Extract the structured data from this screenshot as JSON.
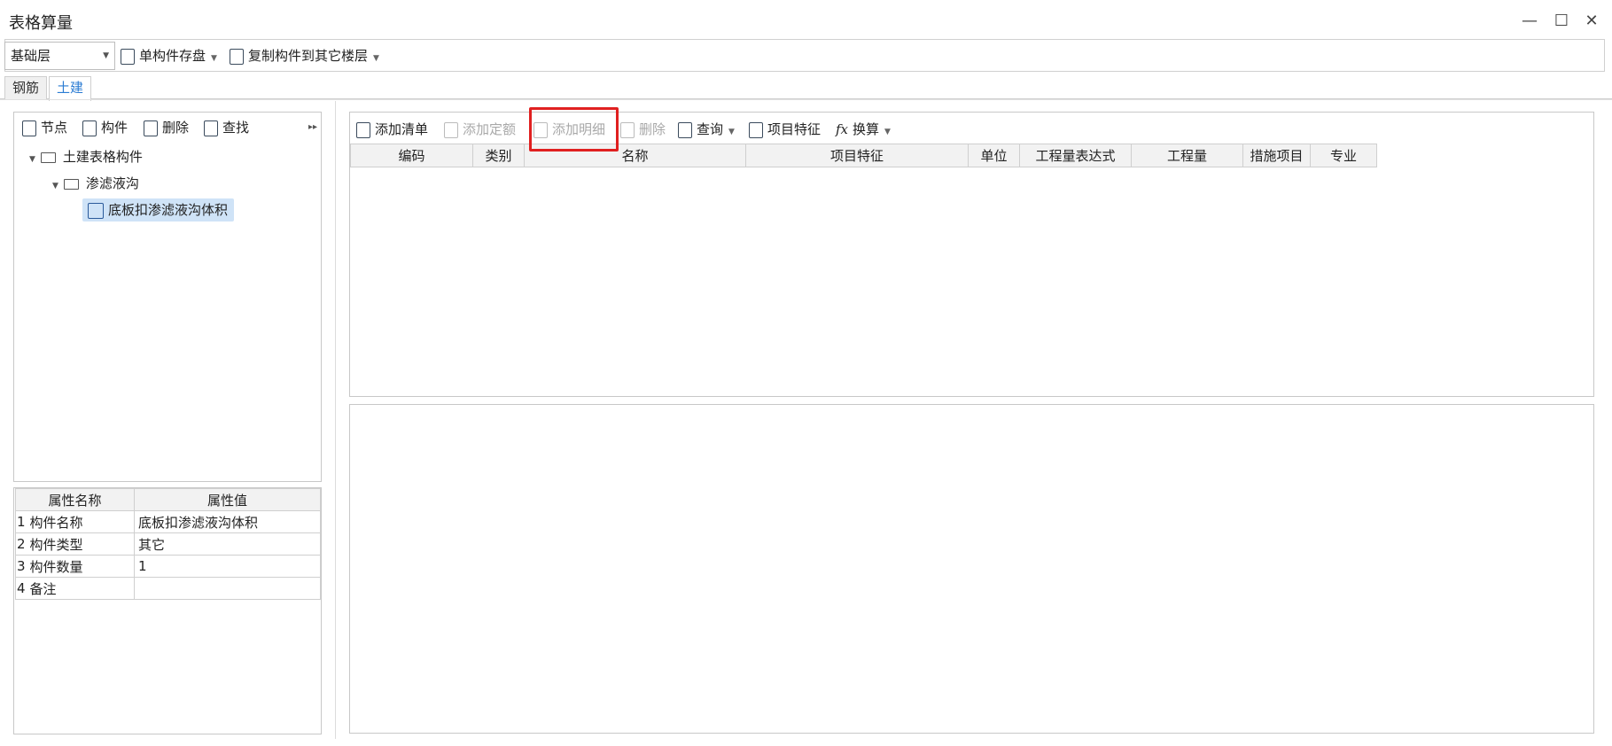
{
  "window": {
    "title": "表格算量"
  },
  "toolbar": {
    "floor_select": "基础层",
    "save_component": "单构件存盘",
    "copy_to_floor": "复制构件到其它楼层"
  },
  "tabs": [
    "钢筋",
    "土建"
  ],
  "left_toolbar": {
    "node": "节点",
    "component": "构件",
    "delete": "删除",
    "find": "查找"
  },
  "tree": {
    "root": "土建表格构件",
    "child": "渗滤液沟",
    "leaf": "底板扣渗滤液沟体积"
  },
  "props": {
    "headers": [
      "属性名称",
      "属性值"
    ],
    "rows": [
      {
        "n": "1",
        "name": "构件名称",
        "value": "底板扣渗滤液沟体积"
      },
      {
        "n": "2",
        "name": "构件类型",
        "value": "其它"
      },
      {
        "n": "3",
        "name": "构件数量",
        "value": "1"
      },
      {
        "n": "4",
        "name": "备注",
        "value": ""
      }
    ]
  },
  "right_toolbar": {
    "add_list": "添加清单",
    "add_quota": "添加定额",
    "add_detail": "添加明细",
    "delete": "删除",
    "query": "查询",
    "features": "项目特征",
    "convert": "换算"
  },
  "grid": {
    "headers": [
      "编码",
      "类别",
      "名称",
      "项目特征",
      "单位",
      "工程量表达式",
      "工程量",
      "措施项目",
      "专业"
    ]
  }
}
